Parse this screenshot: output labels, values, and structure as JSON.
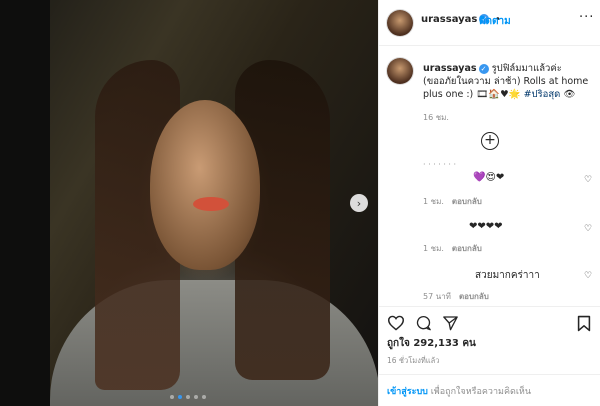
{
  "post": {
    "username": "urassayas",
    "verified_badge": "✓",
    "follow_separator": "•",
    "follow_label": "ติดตาม",
    "more_label": "···",
    "next_label": "›",
    "carousel_index": 1,
    "carousel_count": 5
  },
  "caption": {
    "username": "urassayas",
    "text": "รูปฟิล์มมาแล้วค่ะ (ขออภัยในความ ล่าช้า) Rolls at home plus one :) ",
    "emoji": "🎞🏠♥🌟",
    "hashtag": "#ปริอสุด",
    "trailing_emoji": "👁",
    "time": "16 ชม."
  },
  "comments": [
    {
      "dots": "· · · · · · ·",
      "emoji": "💜😍❤",
      "time": "1 ชม.",
      "reply": "ตอบกลับ"
    },
    {
      "emoji": "❤❤❤❤",
      "time": "1 ชม.",
      "reply": "ตอบกลับ"
    },
    {
      "text": "สวยมากคร่าาา",
      "time": "57 นาที",
      "reply": "ตอบกลับ"
    }
  ],
  "actions": {
    "like_icon": "heart-outline",
    "comment_icon": "comment-bubble",
    "share_icon": "paper-plane",
    "save_icon": "bookmark"
  },
  "likes": {
    "text": "ถูกใจ 292,133 คน"
  },
  "timestamp": "16 ชั่วโมงที่แล้ว",
  "footer": {
    "login_link": "เข้าสู่ระบบ",
    "rest": " เพื่อถูกใจหรือความคิดเห็น"
  },
  "colors": {
    "accent": "#0095f6",
    "muted": "#8e8e8e",
    "text": "#262626"
  }
}
